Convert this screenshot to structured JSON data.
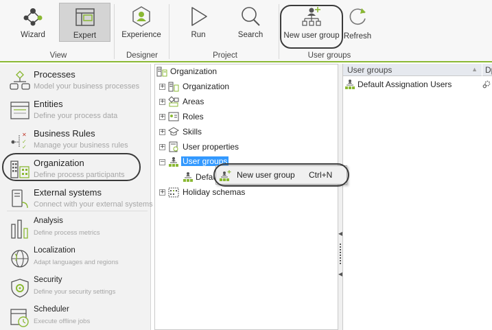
{
  "ribbon": {
    "buttons": {
      "wizard": "Wizard",
      "expert": "Expert",
      "experience": "Experience",
      "run": "Run",
      "search": "Search",
      "new_user_group": "New user group",
      "refresh": "Refresh"
    },
    "groups": {
      "view": "View",
      "designer": "Designer",
      "project": "Project",
      "user_groups": "User groups"
    },
    "active_button": "Expert"
  },
  "leftnav": {
    "items": [
      {
        "title": "Processes",
        "subtitle": "Model your business processes"
      },
      {
        "title": "Entities",
        "subtitle": "Define your process data"
      },
      {
        "title": "Business Rules",
        "subtitle": "Manage your business rules"
      },
      {
        "title": "Organization",
        "subtitle": "Define process participants"
      },
      {
        "title": "External systems",
        "subtitle": "Connect with your external systems"
      },
      {
        "title": "Analysis",
        "subtitle": "Define process metrics"
      },
      {
        "title": "Localization",
        "subtitle": "Adapt languages and regions"
      },
      {
        "title": "Security",
        "subtitle": "Define your security settings"
      },
      {
        "title": "Scheduler",
        "subtitle": "Execute offline jobs"
      }
    ]
  },
  "tree": {
    "root": "Organization",
    "nodes": [
      {
        "label": "Organization",
        "expander": "+"
      },
      {
        "label": "Areas",
        "expander": "+"
      },
      {
        "label": "Roles",
        "expander": "+"
      },
      {
        "label": "Skills",
        "expander": "+"
      },
      {
        "label": "User properties",
        "expander": "+"
      },
      {
        "label": "User groups",
        "expander": "−"
      },
      {
        "label": "Holiday schemas",
        "expander": "+"
      }
    ],
    "child": "Defau"
  },
  "context_menu": {
    "item_label": "New user group",
    "shortcut": "Ctrl+N"
  },
  "grid": {
    "columns": [
      "User groups",
      "Dp"
    ],
    "rows": [
      "Default Assignation Users"
    ]
  },
  "colors": {
    "accent_green": "#8ab833",
    "selection_blue": "#3399ff",
    "subtitle_gray": "#a6a6a6"
  }
}
